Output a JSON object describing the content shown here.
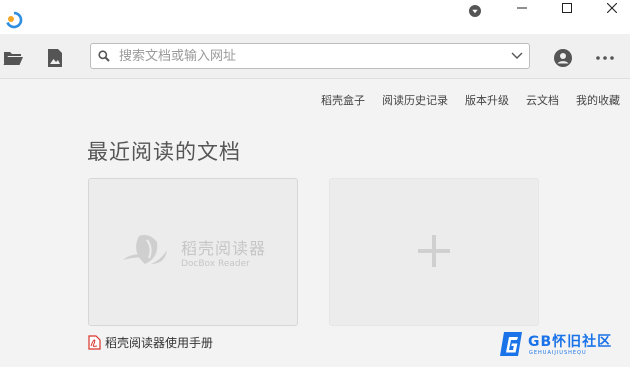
{
  "toolbar": {
    "search_placeholder": "搜索文档或输入网址"
  },
  "top_links": [
    {
      "label": "稻壳盒子"
    },
    {
      "label": "阅读历史记录"
    },
    {
      "label": "版本升级"
    },
    {
      "label": "云文档"
    },
    {
      "label": "我的收藏"
    }
  ],
  "main": {
    "heading": "最近阅读的文档",
    "recent_doc": {
      "watermark_name": "稻壳阅读器",
      "watermark_sub": "DocBox Reader",
      "title": "稻壳阅读器使用手册"
    }
  },
  "site_watermark": {
    "text": "GB怀旧社区",
    "sub": "GEHUAIJIUSHEQU"
  },
  "colors": {
    "accent": "#1a73e8",
    "pdf_red": "#d9342b",
    "logo_blue": "#2f8ee0",
    "logo_orange": "#f5a623"
  }
}
